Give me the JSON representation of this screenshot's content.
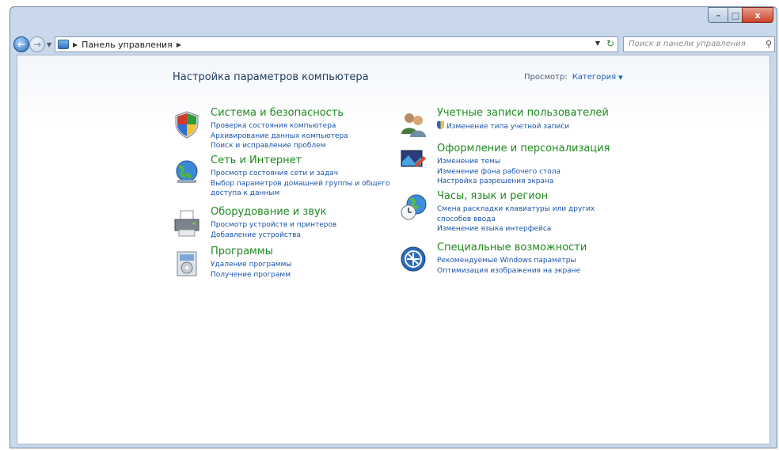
{
  "window": {
    "minimize": "–",
    "maximize": "□",
    "close": "x"
  },
  "nav": {
    "back": "←",
    "forward": "→",
    "dropdown": "▼"
  },
  "address": {
    "crumb": "Панель управления",
    "arrow": "▶",
    "dropdown": "▼",
    "refresh": "↻"
  },
  "search": {
    "placeholder": "Поиск в панели управления",
    "icon": "⚲"
  },
  "header": {
    "title": "Настройка параметров компьютера",
    "view_label": "Просмотр:",
    "view_value": "Категория",
    "view_dd": "▼"
  },
  "categories": [
    {
      "title": "Система и безопасность",
      "icon": "shield-icon",
      "links": [
        "Проверка состояния компьютера",
        "Архивирование данных компьютера",
        "Поиск и исправление проблем"
      ]
    },
    {
      "title": "Сеть и Интернет",
      "icon": "network-globe-icon",
      "links": [
        "Просмотр состояния сети и задач",
        "Выбор параметров домашней группы и общего доступа к данным"
      ]
    },
    {
      "title": "Оборудование и звук",
      "icon": "printer-icon",
      "links": [
        "Просмотр устройств и принтеров",
        "Добавление устройства"
      ]
    },
    {
      "title": "Программы",
      "icon": "programs-icon",
      "links": [
        "Удаление программы",
        "Получение программ"
      ]
    },
    {
      "title": "Учетные записи пользователей",
      "icon": "users-icon",
      "links": [
        "Изменение типа учетной записи"
      ]
    },
    {
      "title": "Оформление и персонализация",
      "icon": "personalization-icon",
      "links": [
        "Изменение темы",
        "Изменение фона рабочего стола",
        "Настройка разрешения экрана"
      ]
    },
    {
      "title": "Часы, язык и регион",
      "icon": "clock-globe-icon",
      "links": [
        "Смена раскладки клавиатуры или других способов ввода",
        "Изменение языка интерфейса"
      ]
    },
    {
      "title": "Специальные возможности",
      "icon": "accessibility-icon",
      "links": [
        "Рекомендуемые Windows параметры",
        "Оптимизация изображения на экране"
      ]
    }
  ]
}
